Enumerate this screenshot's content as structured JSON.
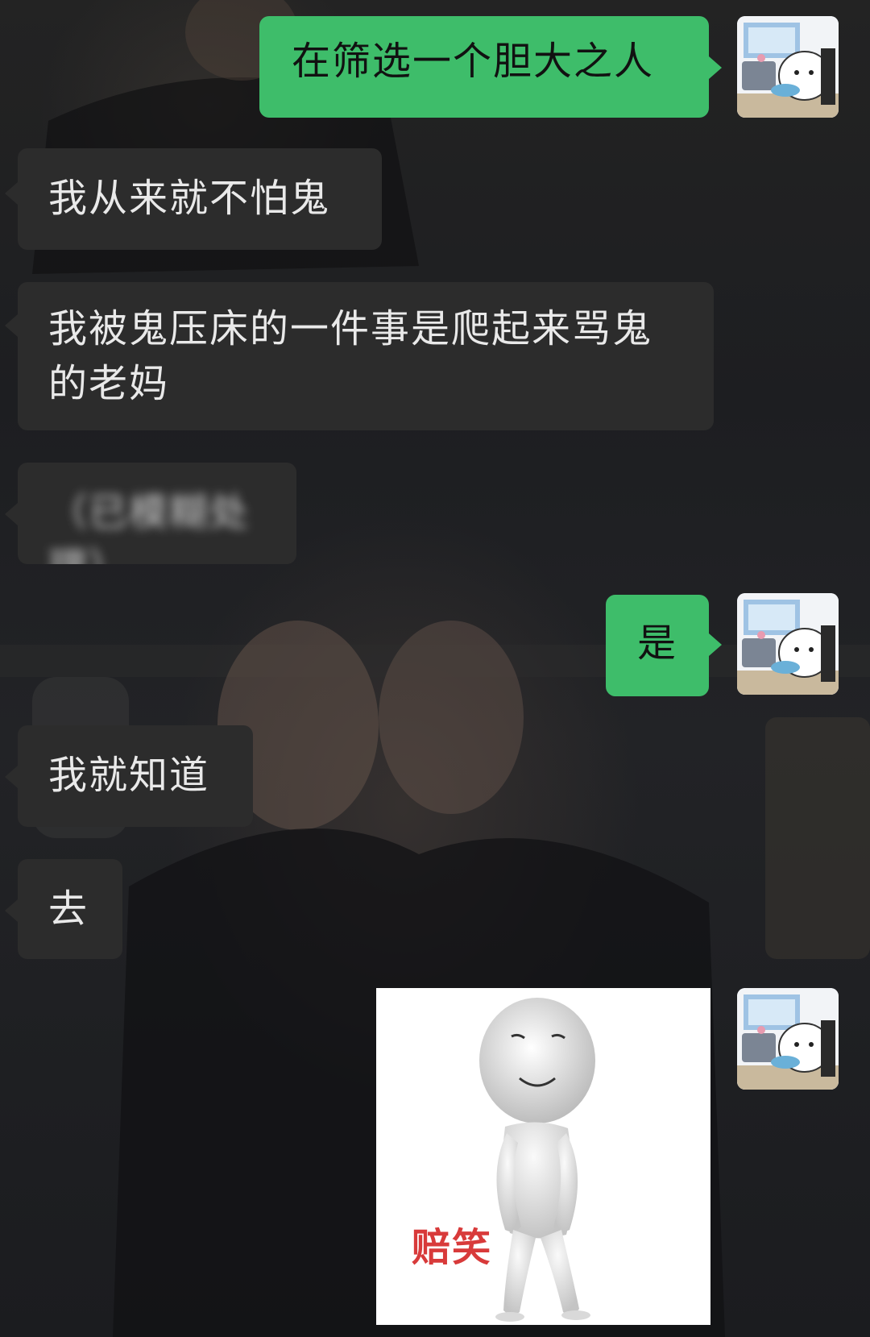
{
  "messages": [
    {
      "id": "m1",
      "side": "sent",
      "text": "在筛选一个胆大之人"
    },
    {
      "id": "m2",
      "side": "received",
      "text": "我从来就不怕鬼"
    },
    {
      "id": "m3",
      "side": "received",
      "line1": "我被鬼压床的一件事是爬起来骂鬼",
      "line2": "的老妈"
    },
    {
      "id": "m4",
      "side": "received",
      "text": "（已模糊处理）"
    },
    {
      "id": "m5",
      "side": "sent",
      "text": "是"
    },
    {
      "id": "m6",
      "side": "received",
      "text": "我就知道"
    },
    {
      "id": "m7",
      "side": "received",
      "text": "去"
    },
    {
      "id": "m8",
      "side": "sent",
      "type": "sticker",
      "caption": "赔笑"
    }
  ],
  "icons": {
    "avatar": "bear-with-laptop-avatar-icon",
    "sticker": "white-3d-figure-smiling-sticker"
  },
  "colors": {
    "sent_bubble": "#3ebd6a",
    "received_bubble": "#2c2c2c",
    "received_text": "#e9e9e9",
    "sticker_caption": "#d83a3a"
  }
}
